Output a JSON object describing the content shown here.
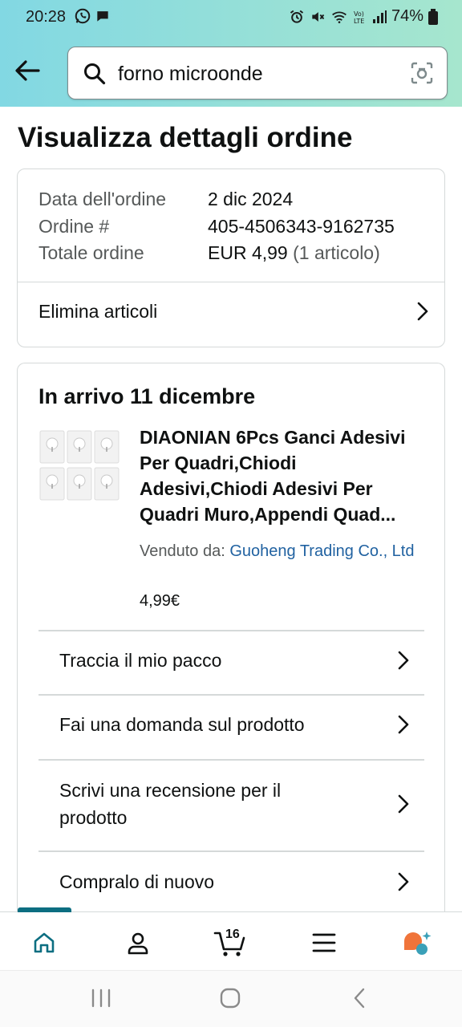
{
  "status_bar": {
    "time": "20:28",
    "battery": "74%"
  },
  "search": {
    "query": "forno microonde"
  },
  "page": {
    "title": "Visualizza dettagli ordine"
  },
  "order_summary": {
    "date_label": "Data dell'ordine",
    "date_value": "2 dic 2024",
    "number_label": "Ordine #",
    "number_value": "405-4506343-9162735",
    "total_label": "Totale ordine",
    "total_value": "EUR 4,99",
    "total_items": "(1 articolo)",
    "remove_items_label": "Elimina articoli"
  },
  "shipment": {
    "arrival": "In arrivo 11 dicembre",
    "product_title": "DIAONIAN 6Pcs Ganci Adesivi Per Quadri,Chiodi Adesivi,Chiodi Adesivi Per Quadri Muro,Appendi Quad...",
    "seller_prefix": "Venduto da: ",
    "seller_name": "Guoheng Trading Co., Ltd",
    "price": "4,99€",
    "actions": [
      "Traccia il mio pacco",
      "Fai una domanda sul prodotto",
      "Scrivi una recensione per il prodotto",
      "Compralo di nuovo"
    ]
  },
  "bottom_nav": {
    "cart_count": "16"
  },
  "colors": {
    "header_start": "#82d8e3",
    "header_end": "#a6e6ce",
    "link": "#2162a1",
    "active_tab": "#0c6e81"
  }
}
